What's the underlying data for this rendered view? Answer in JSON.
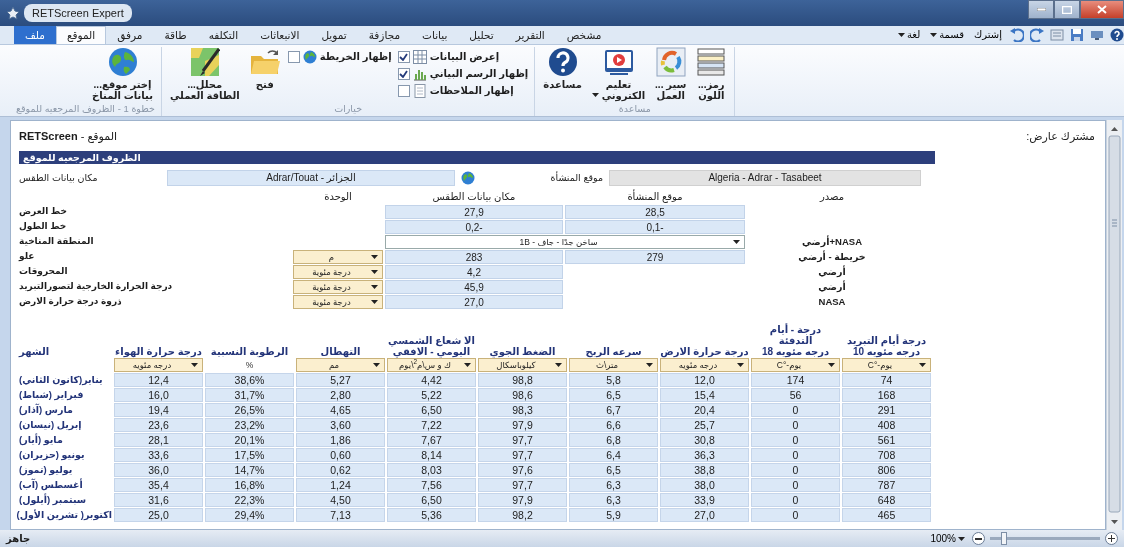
{
  "window": {
    "title": "RETScreen Expert"
  },
  "ribbon": {
    "tabs": [
      {
        "label": "مشخص",
        "kind": "tab",
        "selected": false
      },
      {
        "label": "التقرير",
        "kind": "tab",
        "selected": false
      },
      {
        "label": "تحليل",
        "kind": "tab",
        "selected": false
      },
      {
        "label": "بيانات",
        "kind": "tab",
        "selected": false
      },
      {
        "label": "مجازفة",
        "kind": "tab",
        "selected": false
      },
      {
        "label": "تمويل",
        "kind": "tab",
        "selected": false
      },
      {
        "label": "الانبعاثات",
        "kind": "tab",
        "selected": false
      },
      {
        "label": "التكلفه",
        "kind": "tab",
        "selected": false
      },
      {
        "label": "طاقة",
        "kind": "tab",
        "selected": false
      },
      {
        "label": "مرفق",
        "kind": "tab",
        "selected": false
      },
      {
        "label": "الموقع",
        "kind": "tab",
        "selected": true
      },
      {
        "label": "ملف",
        "kind": "file",
        "selected": false
      }
    ],
    "quick_access": [
      {
        "label": "إشترك",
        "dropdown": false
      },
      {
        "label": "قسمة",
        "dropdown": true
      },
      {
        "label": "لغة",
        "dropdown": true
      }
    ],
    "groups": [
      {
        "label": "مساعدة",
        "items": [
          {
            "kind": "large",
            "lines": [
              "رمز...",
              "اللون"
            ],
            "dropdown": false
          },
          {
            "kind": "large",
            "lines": [
              "سير ...",
              "العمل"
            ],
            "dropdown": false
          },
          {
            "kind": "large",
            "lines": [
              "تعليم",
              "الكتروني"
            ],
            "dropdown": true
          },
          {
            "kind": "large",
            "lines": [
              "مساعدة"
            ],
            "dropdown": false
          }
        ]
      },
      {
        "label": "خيارات",
        "items": [
          {
            "kind": "checks",
            "checks": [
              {
                "label": "إعرض البيانات",
                "checked": true
              },
              {
                "label": "إظهار الرسم البياني",
                "checked": true
              },
              {
                "label": "إظهار الملاحظات",
                "checked": false
              }
            ]
          },
          {
            "kind": "checks",
            "checks": [
              {
                "label": "إظهار الخريطة",
                "checked": false
              }
            ]
          },
          {
            "kind": "large",
            "lines": [
              "فتح"
            ],
            "dropdown": false
          },
          {
            "kind": "large",
            "lines": [
              "محلل...",
              "الطاقة العملي"
            ],
            "dropdown": false
          }
        ]
      },
      {
        "label": "خطوة 1 - الظروف المرجعيه للموقع",
        "items": [
          {
            "kind": "large",
            "lines": [
              "إختر موقع...",
              "بيانات المناخ"
            ],
            "dropdown": false
          }
        ]
      }
    ]
  },
  "page": {
    "title": "**RETScreen** - الموقع",
    "viewer": "مشترك عارض:",
    "section": "الظروف المرجعيه للموقع",
    "weather_location": {
      "label": "مكان بيانات الطقس",
      "value": "Adrar/Touat - الجزائر"
    },
    "facility_location": {
      "label": "موقع المنشأة",
      "value": "Algeria - Adrar - Tasabeet"
    },
    "columns": [
      "مصدر",
      "موقع المنشأة",
      "مكان بيانات الطقس",
      "الوحدة"
    ],
    "rows": [
      {
        "kind": "values",
        "label": "خط العرض",
        "weather": "27,9",
        "facility": "28,5"
      },
      {
        "kind": "values",
        "label": "خط الطول",
        "weather": "-0,2",
        "facility": "-0,1"
      },
      {
        "kind": "dropdown",
        "label": "المنطقة المناخية",
        "value": "ساخن جدًا - جاف - 1B",
        "source": "NASA+أرضي"
      },
      {
        "kind": "values",
        "label": "علو",
        "unit": "م",
        "weather": "283",
        "facility": "279",
        "source": "خريطة - أرضي"
      },
      {
        "kind": "values",
        "label": "المحروقات",
        "unit": "درجة مئوية",
        "weather": "4,2",
        "source": "أرضي"
      },
      {
        "kind": "values",
        "label": "درجة الحرارة الخارجية لتصورالتبريد",
        "unit": "درجة مئوية",
        "weather": "45,9",
        "source": "أرضي"
      },
      {
        "kind": "values",
        "label": "ذروة درجة حرارة الارض",
        "unit": "درجة مئوية",
        "weather": "27,0",
        "source": "NASA"
      }
    ]
  },
  "monthly": {
    "columns": [
      {
        "lines": [
          "درجة أيام التبريد",
          "درجه مئويه 10"
        ],
        "unit": "يوم-°C",
        "dropdown": true
      },
      {
        "lines": [
          "درجة - أيام",
          "التدفئة",
          "درجه مئويه 18"
        ],
        "unit": "يوم-°C",
        "dropdown": true
      },
      {
        "lines": [
          "درجة حرارة الارض"
        ],
        "unit": "درجه مئويه",
        "dropdown": true
      },
      {
        "lines": [
          "سرعه الريح"
        ],
        "unit": "متر\\ث",
        "dropdown": true
      },
      {
        "lines": [
          "الضغط الجوي"
        ],
        "unit": "كيلوباسكال",
        "dropdown": true
      },
      {
        "lines": [
          "الا شعاع الشمسي",
          "اليومي - الافقي"
        ],
        "unit": "ك و س\\م$^{2}$\\يوم",
        "dropdown": true
      },
      {
        "lines": [
          "التهطال"
        ],
        "unit": "مم",
        "dropdown": true
      },
      {
        "lines": [
          "الرطوبة النسبية"
        ],
        "unit": "%",
        "dropdown": false
      },
      {
        "lines": [
          "درجة حرارة الهواء"
        ],
        "unit": "درجه مئويه",
        "dropdown": true
      },
      {
        "lines": [
          "الشهر"
        ]
      }
    ],
    "rows": [
      {
        "values": [
          "74",
          "174",
          "12,0",
          "5,8",
          "98,8",
          "4,42",
          "5,27",
          "38,6%",
          "12,4"
        ],
        "month": "يناير(كانون الثاني)"
      },
      {
        "values": [
          "168",
          "56",
          "15,4",
          "6,5",
          "98,6",
          "5,22",
          "2,80",
          "31,7%",
          "16,0"
        ],
        "month": "فبراير (شباط)"
      },
      {
        "values": [
          "291",
          "0",
          "20,4",
          "6,7",
          "98,3",
          "6,50",
          "4,65",
          "26,5%",
          "19,4"
        ],
        "month": "مارس (آذار)"
      },
      {
        "values": [
          "408",
          "0",
          "25,7",
          "6,6",
          "97,9",
          "7,22",
          "3,60",
          "23,2%",
          "23,6"
        ],
        "month": "إبريل (نيسان)"
      },
      {
        "values": [
          "561",
          "0",
          "30,8",
          "6,8",
          "97,7",
          "7,67",
          "1,86",
          "20,1%",
          "28,1"
        ],
        "month": "مايو (أيار)"
      },
      {
        "values": [
          "708",
          "0",
          "36,3",
          "6,4",
          "97,7",
          "8,14",
          "0,60",
          "17,5%",
          "33,6"
        ],
        "month": "يونيو (حزيران)"
      },
      {
        "values": [
          "806",
          "0",
          "38,8",
          "6,5",
          "97,6",
          "8,03",
          "0,62",
          "14,7%",
          "36,0"
        ],
        "month": "يوليو (تموز)"
      },
      {
        "values": [
          "787",
          "0",
          "38,0",
          "6,3",
          "97,7",
          "7,56",
          "1,24",
          "16,8%",
          "35,4"
        ],
        "month": "أغسطس (آب)"
      },
      {
        "values": [
          "648",
          "0",
          "33,9",
          "6,3",
          "97,9",
          "6,50",
          "4,50",
          "22,3%",
          "31,6"
        ],
        "month": "سبتمبر (أيلول)"
      },
      {
        "values": [
          "465",
          "0",
          "27,0",
          "5,9",
          "98,2",
          "5,36",
          "7,13",
          "29,4%",
          "25,0"
        ],
        "month": "اكتوبر( تشرين الأول)"
      }
    ]
  },
  "status_bar": {
    "text": "جاهز",
    "zoom": "100%",
    "zoom_slider": {
      "level": 0.13
    }
  }
}
